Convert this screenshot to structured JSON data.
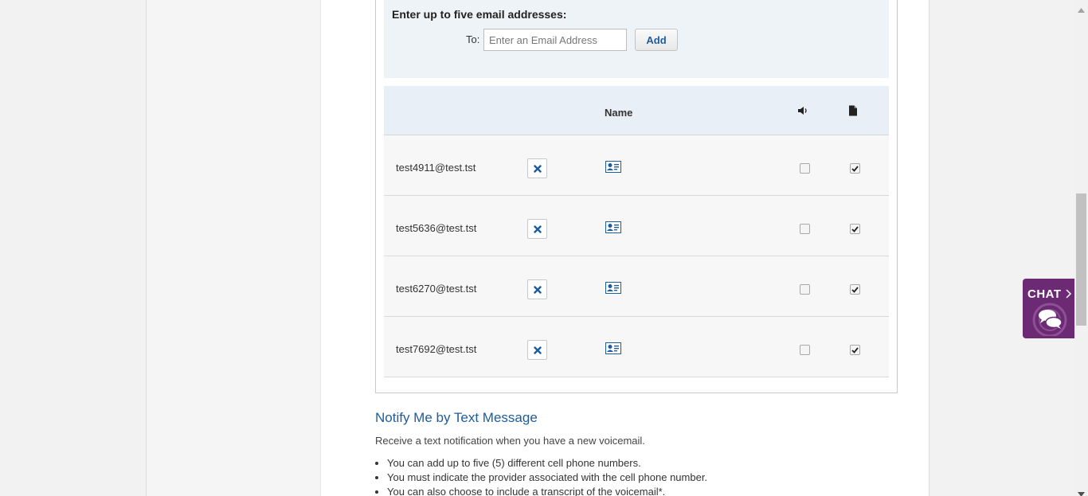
{
  "email_entry": {
    "heading": "Enter up to five email addresses:",
    "to_label": "To:",
    "input_placeholder": "Enter an Email Address",
    "input_value": "",
    "add_label": "Add"
  },
  "table": {
    "name_header": "Name",
    "voice_header_icon": "speaker-icon",
    "transcript_header_icon": "document-icon",
    "rows": [
      {
        "email": "test4911@test.tst",
        "voice_attached": false,
        "transcript": true
      },
      {
        "email": "test5636@test.tst",
        "voice_attached": false,
        "transcript": true
      },
      {
        "email": "test6270@test.tst",
        "voice_attached": false,
        "transcript": true
      },
      {
        "email": "test7692@test.tst",
        "voice_attached": false,
        "transcript": true
      }
    ]
  },
  "text_section": {
    "title": "Notify Me by Text Message",
    "description": "Receive a text notification when you have a new voicemail.",
    "bullets": [
      "You can add up to five (5) different cell phone numbers.",
      "You must indicate the provider associated with the cell phone number.",
      "You can also choose to include a transcript of the voicemail*."
    ]
  },
  "chat": {
    "label": "CHAT",
    "accent": "#6b2a73"
  },
  "colors": {
    "link_blue": "#1d5d9b",
    "panel_bg": "#eef3f8",
    "header_bg": "#e8eff6",
    "row_bg": "#f7f7f7"
  }
}
